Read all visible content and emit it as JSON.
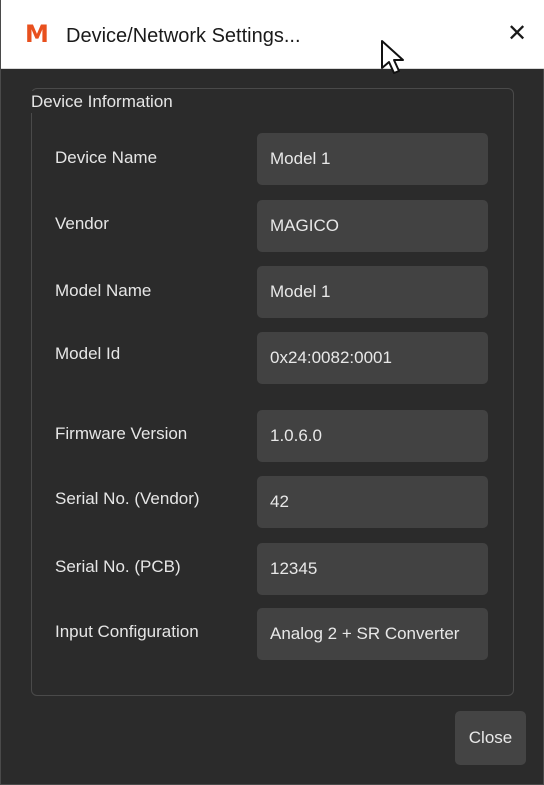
{
  "window": {
    "logo": "M",
    "title": "Device/Network Settings...",
    "close_glyph": "✕",
    "close_icon": "close-icon"
  },
  "device_info": {
    "group_title": "Device Information",
    "rows": [
      {
        "label": "Device Name",
        "value": "Model 1"
      },
      {
        "label": "Vendor",
        "value": "MAGICO"
      },
      {
        "label": "Model Name",
        "value": "Model 1"
      },
      {
        "label": "Model Id",
        "value": "0x24:0082:0001"
      },
      {
        "label": "Firmware Version",
        "value": "1.0.6.0"
      },
      {
        "label": "Serial No. (Vendor)",
        "value": "42"
      },
      {
        "label": "Serial No. (PCB)",
        "value": "12345"
      },
      {
        "label": "Input Configuration",
        "value": "Analog 2 + SR Converter"
      }
    ]
  },
  "footer": {
    "close_label": "Close"
  },
  "colors": {
    "background": "#2b2b2b",
    "field": "#424242",
    "logo": "#e8501e",
    "text": "#e6e6e6"
  }
}
